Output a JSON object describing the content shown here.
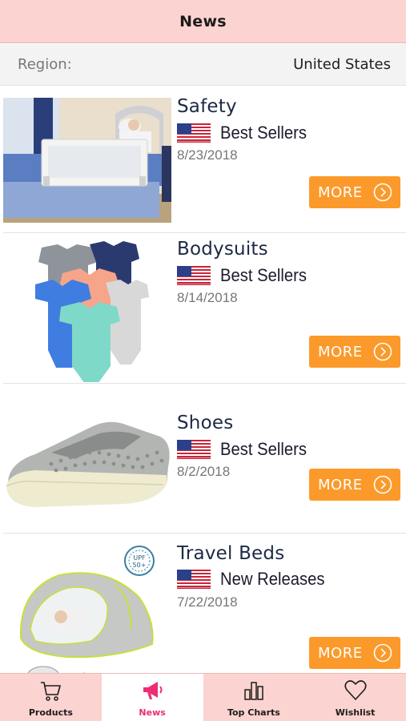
{
  "header": {
    "title": "News"
  },
  "region": {
    "label": "Region:",
    "value": "United States"
  },
  "news_items": [
    {
      "category": "Safety",
      "list_name": "Best Sellers",
      "date": "8/23/2018",
      "more_label": "MORE"
    },
    {
      "category": "Bodysuits",
      "list_name": "Best Sellers",
      "date": "8/14/2018",
      "more_label": "MORE"
    },
    {
      "category": "Shoes",
      "list_name": "Best Sellers",
      "date": "8/2/2018",
      "more_label": "MORE"
    },
    {
      "category": "Travel Beds",
      "list_name": "New Releases",
      "date": "7/22/2018",
      "more_label": "MORE"
    }
  ],
  "tabs": [
    {
      "label": "Products",
      "icon": "cart-icon",
      "active": false
    },
    {
      "label": "News",
      "icon": "megaphone-icon",
      "active": true
    },
    {
      "label": "Top Charts",
      "icon": "bar-chart-icon",
      "active": false
    },
    {
      "label": "Wishlist",
      "icon": "heart-icon",
      "active": false
    }
  ],
  "colors": {
    "header_bg": "#fbd3d0",
    "accent": "#fb9a2b",
    "active_tab": "#ee2c74",
    "region_bg": "#f3f3f3"
  }
}
